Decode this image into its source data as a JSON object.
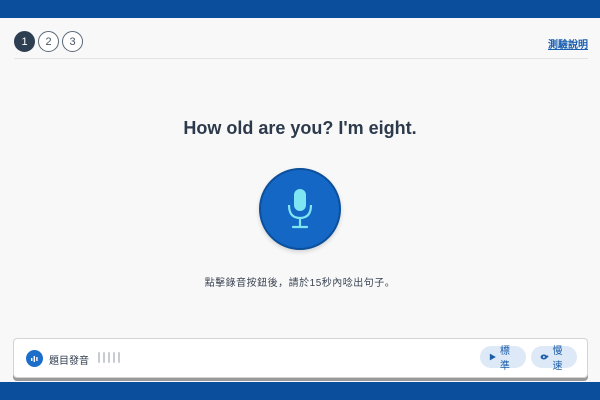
{
  "steps": [
    "1",
    "2",
    "3"
  ],
  "active_step": 0,
  "help_link": "測驗說明",
  "question": "How old are you? I'm eight.",
  "instruction": "點擊錄音按鈕後，請於15秒內唸出句子。",
  "audio": {
    "label": "題目發音",
    "normal_label": "標準",
    "slow_label": "慢速"
  },
  "colors": {
    "brand": "#0b4f9c",
    "mic_fill": "#1467c5",
    "mic_glyph": "#7ee6f2",
    "step_active": "#2f3f52",
    "link": "#1a5fb0"
  },
  "icons": {
    "mic": "microphone-icon",
    "speaker": "speaker-icon",
    "play": "play-icon",
    "slow": "turtle-icon"
  }
}
